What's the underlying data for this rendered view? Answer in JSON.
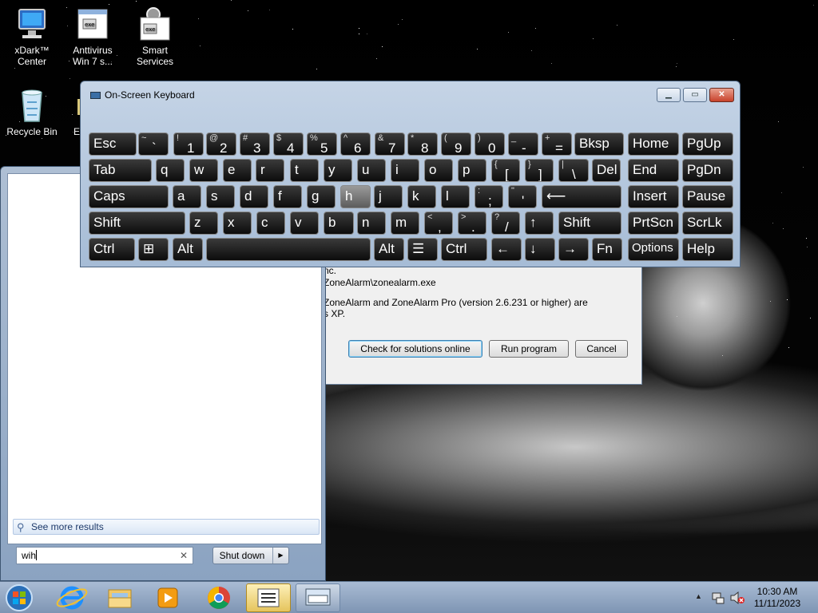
{
  "desktop_icons": [
    {
      "label_l1": "xDark™",
      "label_l2": "Center",
      "icon": "computer-icon"
    },
    {
      "label_l1": "Anttivirus",
      "label_l2": "Win 7 s...",
      "icon": "program-window-icon"
    },
    {
      "label_l1": "Smart",
      "label_l2": "Services",
      "icon": "gear-window-icon"
    },
    {
      "label_l1": "Recycle Bin",
      "label_l2": "",
      "icon": "recycle-bin-icon"
    },
    {
      "label_l1": "Ev",
      "label_l2": "",
      "icon": "program-icon"
    }
  ],
  "start_menu": {
    "see_more": "See more results",
    "search_value": "wih",
    "shutdown_label": "Shut down",
    "shutdown_arrow": "▶"
  },
  "dialog": {
    "line1": "nc.",
    "line2": "ZoneAlarm\\zonealarm.exe",
    "line3": "ZoneAlarm and ZoneAlarm Pro (version 2.6.231 or higher) are",
    "line4": "s XP.",
    "buttons": {
      "check": "Check for solutions online",
      "run": "Run program",
      "cancel": "Cancel"
    }
  },
  "osk": {
    "title": "On-Screen Keyboard",
    "caption": {
      "minimize": "▁",
      "maximize": "▭",
      "close": "✕"
    },
    "row1": [
      {
        "main": "Esc"
      },
      {
        "top": "~",
        "bot": "`"
      },
      {
        "top": "!",
        "bot": "1"
      },
      {
        "top": "@",
        "bot": "2"
      },
      {
        "top": "#",
        "bot": "3"
      },
      {
        "top": "$",
        "bot": "4"
      },
      {
        "top": "%",
        "bot": "5"
      },
      {
        "top": "^",
        "bot": "6"
      },
      {
        "top": "&",
        "bot": "7"
      },
      {
        "top": "*",
        "bot": "8"
      },
      {
        "top": "(",
        "bot": "9"
      },
      {
        "top": ")",
        "bot": "0"
      },
      {
        "top": "_",
        "bot": "-"
      },
      {
        "top": "+",
        "bot": "="
      },
      {
        "main": "Bksp"
      },
      {
        "main": "Home"
      },
      {
        "main": "PgUp"
      }
    ],
    "row2": [
      {
        "main": "Tab"
      },
      {
        "main": "q"
      },
      {
        "main": "w"
      },
      {
        "main": "e"
      },
      {
        "main": "r"
      },
      {
        "main": "t"
      },
      {
        "main": "y"
      },
      {
        "main": "u"
      },
      {
        "main": "i"
      },
      {
        "main": "o"
      },
      {
        "main": "p"
      },
      {
        "top": "{",
        "bot": "["
      },
      {
        "top": "}",
        "bot": "]"
      },
      {
        "top": "|",
        "bot": "\\"
      },
      {
        "main": "Del"
      },
      {
        "main": "End"
      },
      {
        "main": "PgDn"
      }
    ],
    "row3": [
      {
        "main": "Caps"
      },
      {
        "main": "a"
      },
      {
        "main": "s"
      },
      {
        "main": "d"
      },
      {
        "main": "f"
      },
      {
        "main": "g"
      },
      {
        "main": "h"
      },
      {
        "main": "j"
      },
      {
        "main": "k"
      },
      {
        "main": "l"
      },
      {
        "top": ":",
        "bot": ";"
      },
      {
        "top": "\"",
        "bot": "'"
      },
      {
        "main": "⟵"
      },
      {
        "main": "Insert"
      },
      {
        "main": "Pause"
      }
    ],
    "row4": [
      {
        "main": "Shift"
      },
      {
        "main": "z"
      },
      {
        "main": "x"
      },
      {
        "main": "c"
      },
      {
        "main": "v"
      },
      {
        "main": "b"
      },
      {
        "main": "n"
      },
      {
        "main": "m"
      },
      {
        "top": "<",
        "bot": ","
      },
      {
        "top": ">",
        "bot": "."
      },
      {
        "top": "?",
        "bot": "/"
      },
      {
        "main": "↑"
      },
      {
        "main": "Shift"
      },
      {
        "main": "PrtScn"
      },
      {
        "main": "ScrLk"
      }
    ],
    "row5": [
      {
        "main": "Ctrl"
      },
      {
        "main": "⊞"
      },
      {
        "main": "Alt"
      },
      {
        "main": ""
      },
      {
        "main": "Alt"
      },
      {
        "main": "☰"
      },
      {
        "main": "Ctrl"
      },
      {
        "main": "←"
      },
      {
        "main": "↓"
      },
      {
        "main": "→"
      },
      {
        "main": "Fn"
      },
      {
        "main": "Options"
      },
      {
        "main": "Help"
      }
    ]
  },
  "taskbar": {
    "apps": [
      {
        "name": "start-button",
        "icon": "windows-orb-icon"
      },
      {
        "name": "internet-explorer",
        "icon": "internet-explorer-icon"
      },
      {
        "name": "windows-explorer",
        "icon": "folder-icon"
      },
      {
        "name": "media-player",
        "icon": "media-player-icon"
      },
      {
        "name": "chrome",
        "icon": "chrome-icon"
      },
      {
        "name": "task-list",
        "icon": "list-window-icon"
      },
      {
        "name": "on-screen-keyboard",
        "icon": "keyboard-icon"
      }
    ],
    "time": "10:30 AM",
    "date": "11/11/2023",
    "tray_icons": [
      "show-hidden-icons",
      "network-icon",
      "volume-muted-icon"
    ],
    "tray_up_arrow": "▲"
  },
  "colors": {
    "osk_key": "#1a1a1a",
    "osk_key_hover": "#7a7a7a",
    "taskbar": "#8fa5c2",
    "close_button": "#c8422b"
  }
}
